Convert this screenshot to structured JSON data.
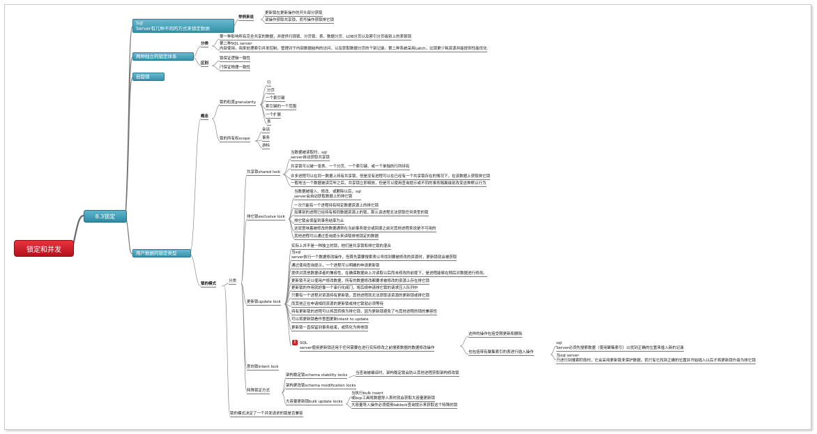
{
  "root": {
    "label": "锁定和并发"
  },
  "mid": {
    "label": "8.3锁定"
  },
  "top_nodes": {
    "n1": "Sql\nServer有几种不同的方式来锁定数据",
    "n2": "两种独立的锁定体系",
    "n3": "自旋锁",
    "n4": "用户数据的锁定类型"
  },
  "s1": {
    "label": "举例来说",
    "items": [
      "更新锁在更新操作的开头部分获取",
      "读操作获取共享锁，而写操作获取排它锁"
    ]
  },
  "s2": {
    "fenlei": {
      "label": "分类",
      "items": [
        "第一种影响所有完全共享的数据，并提供行锁锁、分页锁、表、数据分页、LOB分页以及索引分页级别上的表锁锁",
        "第二种SQL server\n内部使用，用来处理索引并发控制，管理对于内部数据结构的访问，以及获取数据分页的个别记录。第二种系统采用Latch，比锁更少耗资源并能提供性能优化"
      ]
    },
    "qubie": {
      "label": "区别",
      "items": [
        "锁保证逻辑一致性",
        "闩保证物理一致性"
      ]
    }
  },
  "s4": {
    "gainian": {
      "label": "概念",
      "lidu": {
        "label": "锁的粒度granularity",
        "items": [
          "行",
          "分页",
          "一个索引键",
          "索引键的一个范围",
          "一个扩展",
          "表"
        ]
      },
      "suoyouquan": {
        "label": "锁的所有权scope",
        "items": [
          "会话",
          "事务",
          "游标"
        ]
      }
    },
    "moshi": {
      "label": "锁的模式",
      "fenlei": {
        "label": "分类",
        "gongxiang": {
          "label": "共享锁shared lock",
          "items": [
            "当数据被读取时，sql\nserver自动获取共享锁",
            "共享锁可以被一张表、一个分页、一个索引键、或一个单独的行所持有",
            "许多进程可以在同一数据上持有共享锁，但是没有进程可以在已经有一个共享锁存在的情况下，在该数据上获取排它锁",
            "一般地当一个数据被读完毕之后，共享锁立即释放，但是可以使用查询提示或不同的事务隔离级别改变这种默认行为"
          ]
        },
        "paita": {
          "label": "排它锁exclusive lock",
          "items": [
            "当数据被插入、修改、或删除以后，sql\nserver会自动获取数据上的排它锁",
            "一次只能有一个进程持有特定数据资源上的排它锁",
            "如果别的进程已经持有相同数据资源上的锁，那么该进程无法获取任何类型的锁",
            "排它锁会保留到事务结束为止",
            "这就意味着被修改的数据通常在当前事务提交或回滚之前对其他进程来说是不可用的",
            "其他进程可以通过查询提示来读取排他锁定的数据"
          ]
        },
        "gengxin": {
          "label": "更新锁update lock",
          "items": [
            "实际上并不是一种独立的锁，他们是共享锁和排它锁的混合",
            "当sql\nserver执行一个数据修改操作，但首先需要搜索表以寻找到要被修改的资源时，更新锁就会被获取",
            "通过使用查询提示，一个进程可以明确的申请更新锁",
            "提供对其他数据读者的兼容性，在确保数据自上次读取以后而未修改的前提下，是进程能够在稍后对数据进行修改。",
            "更新锁不足以使用户修改数据，所有的数据修改都要求被修改的资源上存在排它锁",
            "更新锁的作用就好像一个串行化阀门，将后续申请排它锁的请求压入队列中",
            "只要有一个进程对资源持有更新锁，其他进程就无法获取该资源的更新锁或排它锁",
            "而其他正在申请相同资源的更新锁或排它锁就必须等待",
            "持有更新锁的进程可以将其转换为排它锁，因为更新锁避免了与其他进程的锁的兼容性",
            "可以将更新锁看作意图更新intent to update",
            "更新锁一直保留到事务结束，或转化为排他锁"
          ],
          "sqlnote": "SQL\nserver使用更新锁还用于任何需要在进行实际修改之前搜索数据的数据修改操作",
          "ops": [
            "这样的操作包括受限更新和删除",
            "也包括带有聚集索引的表进行插入操作"
          ],
          "clustered": "sql\nServer必须先搜索数据（使用聚集索引）以找到正确的位置来插入新的记录",
          "search": "当sql server\n只进行到搜索阶段时，它会采用更新锁来保护数据，而只有它找到正确的位置并开始插入以后才将更新锁升级为排它锁"
        },
        "yixiang": {
          "label": "意向锁intent lock"
        },
        "teshu": {
          "label": "特殊锁定方式",
          "schst": {
            "label": "架构稳定锁schema stability locks",
            "note": "当查询被编译时，架构稳定锁会防止其他进程获取架构修改锁"
          },
          "schmod": {
            "label": "架构更改锁schema modification locks"
          },
          "bulk": {
            "label": "大容量更新锁bulk update locks",
            "items": [
              "当执行bulk insert\n或bcp工具将数据导入表时就会获取大容量更新锁",
              "大容量导入操作必须使用tablock查询提示来获取这个特殊的锁"
            ]
          }
        }
      },
      "note": "锁的模式决定了一个并发请求的锁是否兼容"
    }
  }
}
